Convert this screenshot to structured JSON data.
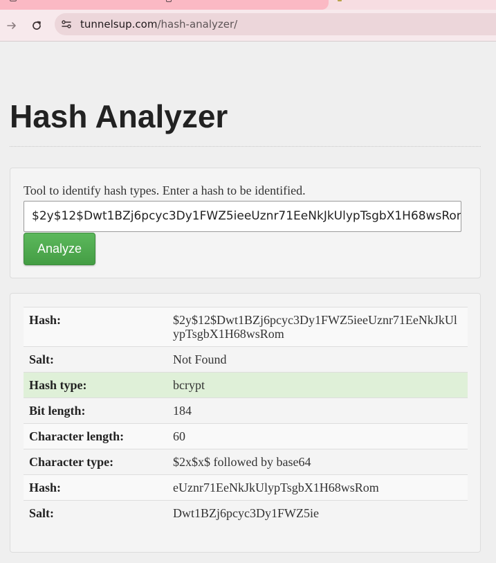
{
  "browser": {
    "url_host": "tunnelsup.com",
    "url_path": "/hash-analyzer/"
  },
  "page": {
    "title": "Hash Analyzer",
    "description": "Tool to identify hash types. Enter a hash to be identified.",
    "hash_input_value": "$2y$12$Dwt1BZj6pcyc3Dy1FWZ5ieeUznr71EeNkJkUlypTsgbX1H68wsRom",
    "analyze_label": "Analyze"
  },
  "results": [
    {
      "label": "Hash:",
      "value": "$2y$12$Dwt1BZj6pcyc3Dy1FWZ5ieeUznr71EeNkJkUlypTsgbX1H68wsRom"
    },
    {
      "label": "Salt:",
      "value": "Not Found"
    },
    {
      "label": "Hash type:",
      "value": "bcrypt"
    },
    {
      "label": "Bit length:",
      "value": "184"
    },
    {
      "label": "Character length:",
      "value": "60"
    },
    {
      "label": "Character type:",
      "value": "$2x$x$ followed by base64"
    },
    {
      "label": "Hash:",
      "value": "eUznr71EeNkJkUlypTsgbX1H68wsRom"
    },
    {
      "label": "Salt:",
      "value": "Dwt1BZj6pcyc3Dy1FWZ5ie"
    }
  ],
  "colors": {
    "success_row": "#dff0d8",
    "analyze_button": "#5cb85c",
    "browser_tab_accent": "#fbb9c4"
  }
}
